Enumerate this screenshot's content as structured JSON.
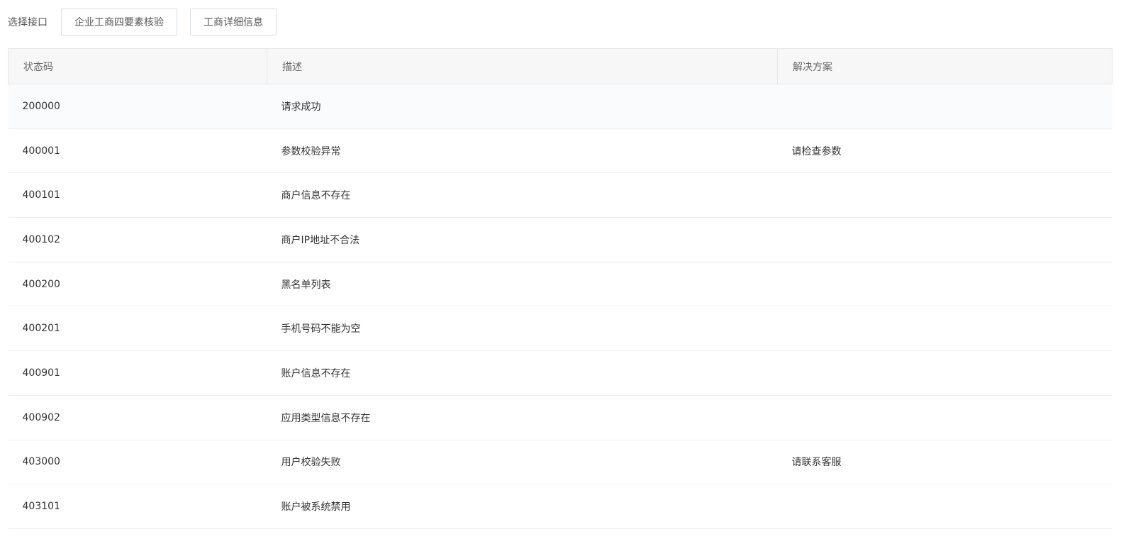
{
  "toolbar": {
    "label": "选择接口",
    "buttons": [
      "企业工商四要素核验",
      "工商详细信息"
    ]
  },
  "table": {
    "headers": [
      "状态码",
      "描述",
      "解决方案"
    ],
    "rows": [
      {
        "code": "200000",
        "desc": "请求成功",
        "solution": ""
      },
      {
        "code": "400001",
        "desc": "参数校验异常",
        "solution": "请检查参数"
      },
      {
        "code": "400101",
        "desc": "商户信息不存在",
        "solution": ""
      },
      {
        "code": "400102",
        "desc": "商户IP地址不合法",
        "solution": ""
      },
      {
        "code": "400200",
        "desc": "黑名单列表",
        "solution": ""
      },
      {
        "code": "400201",
        "desc": "手机号码不能为空",
        "solution": ""
      },
      {
        "code": "400901",
        "desc": "账户信息不存在",
        "solution": ""
      },
      {
        "code": "400902",
        "desc": "应用类型信息不存在",
        "solution": ""
      },
      {
        "code": "403000",
        "desc": "用户校验失败",
        "solution": "请联系客服"
      },
      {
        "code": "403101",
        "desc": "账户被系统禁用",
        "solution": ""
      }
    ]
  }
}
